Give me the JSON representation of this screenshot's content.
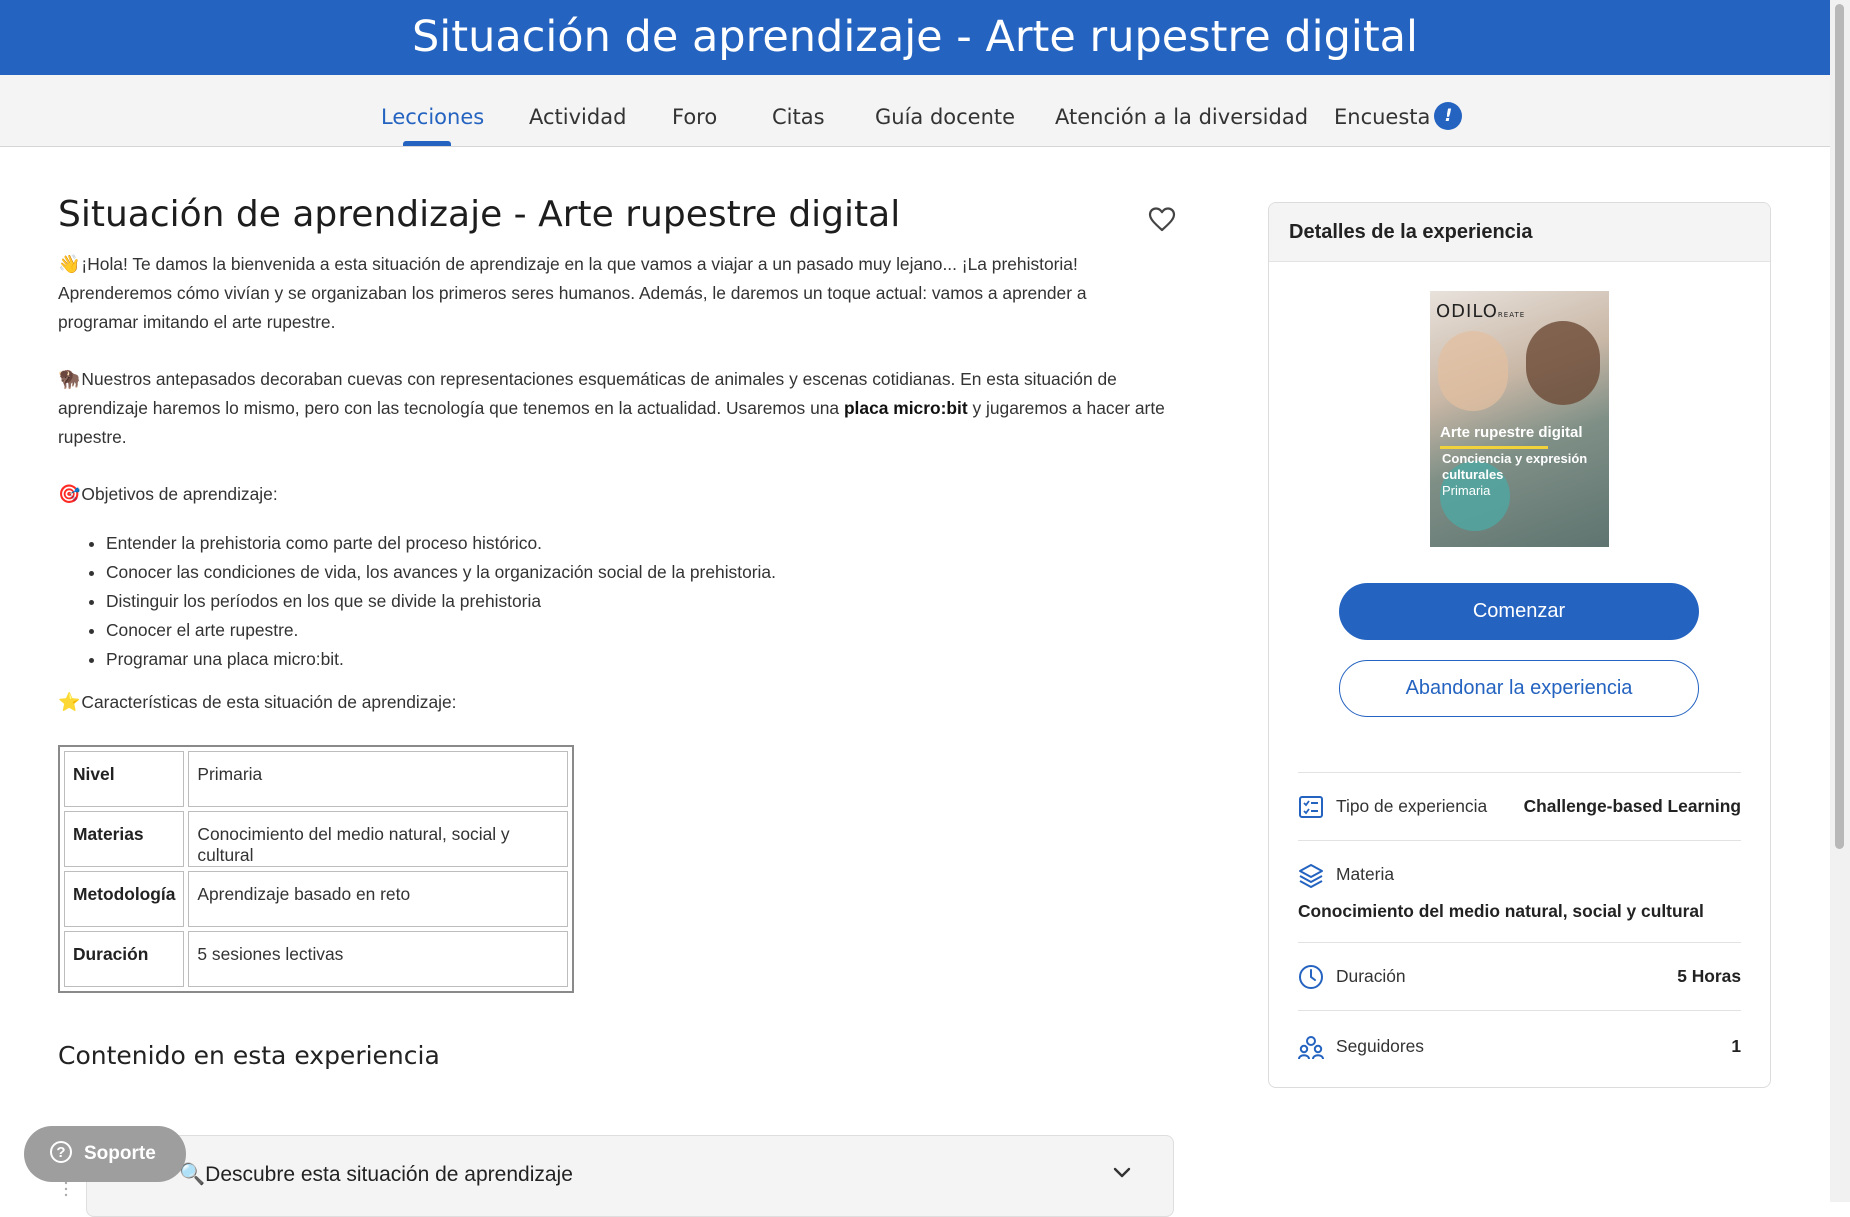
{
  "header": {
    "title": "Situación de aprendizaje - Arte rupestre digital"
  },
  "tabs": [
    {
      "label": "Lecciones",
      "active": true
    },
    {
      "label": "Actividad"
    },
    {
      "label": "Foro"
    },
    {
      "label": "Citas"
    },
    {
      "label": "Guía docente"
    },
    {
      "label": "Atención a la diversidad"
    },
    {
      "label": "Encuesta",
      "badge": "!"
    }
  ],
  "main": {
    "title": "Situación de aprendizaje - Arte rupestre digital",
    "intro_emoji": "👋",
    "intro": "¡Hola! Te damos la bienvenida a esta situación de aprendizaje en la que vamos a viajar a un pasado muy lejano... ¡La prehistoria! Aprenderemos cómo vivían y se organizaban los primeros seres humanos. Además, le daremos un toque actual: vamos a aprender a programar imitando el arte rupestre.",
    "para2_emoji": "🦬",
    "para2_a": "Nuestros antepasados decoraban cuevas con representaciones esquemáticas de animales y escenas cotidianas. En esta situación de aprendizaje haremos lo mismo, pero con las tecnología que tenemos en la actualidad. Usaremos una ",
    "para2_bold": "placa micro:bit",
    "para2_b": " y jugaremos a hacer arte rupestre.",
    "objectives_emoji": "🎯",
    "objectives_title": "Objetivos de aprendizaje:",
    "objectives": [
      "Entender la prehistoria como parte del proceso histórico.",
      "Conocer las condiciones de vida, los avances y la organización social de la prehistoria.",
      "Distinguir los períodos en los que se divide la prehistoria",
      "Conocer el arte rupestre.",
      "Programar una placa micro:bit."
    ],
    "characteristics_emoji": "⭐",
    "characteristics_title": "Características de esta situación de aprendizaje:",
    "table": [
      {
        "key": "Nivel",
        "value": "Primaria"
      },
      {
        "key": "Materias",
        "value": "Conocimiento del medio natural, social y cultural"
      },
      {
        "key": "Metodología",
        "value": "Aprendizaje basado en reto"
      },
      {
        "key": "Duración",
        "value": "5 sesiones lectivas"
      }
    ],
    "content_title": "Contenido en esta experiencia",
    "accordion_emoji": "🔍",
    "accordion_label": "Descubre esta situación de aprendizaje"
  },
  "support": {
    "label": "Soporte",
    "icon": "question-circle-icon"
  },
  "panel": {
    "title": "Detalles de la experiencia",
    "cover": {
      "logo": "ODILO",
      "logo_suffix": "REATE",
      "title": "Arte rupestre digital",
      "subtitle": "Conciencia y expresión culturales",
      "level": "Primaria"
    },
    "start_label": "Comenzar",
    "leave_label": "Abandonar la experiencia",
    "details": {
      "type_label": "Tipo de experiencia",
      "type_value": "Challenge-based Learning",
      "subject_label": "Materia",
      "subject_value": "Conocimiento del medio natural, social y cultural",
      "duration_label": "Duración",
      "duration_value": "5 Horas",
      "followers_label": "Seguidores",
      "followers_value": "1"
    }
  },
  "colors": {
    "brand": "#2463c0",
    "panel_bg": "#f4f4f4"
  }
}
